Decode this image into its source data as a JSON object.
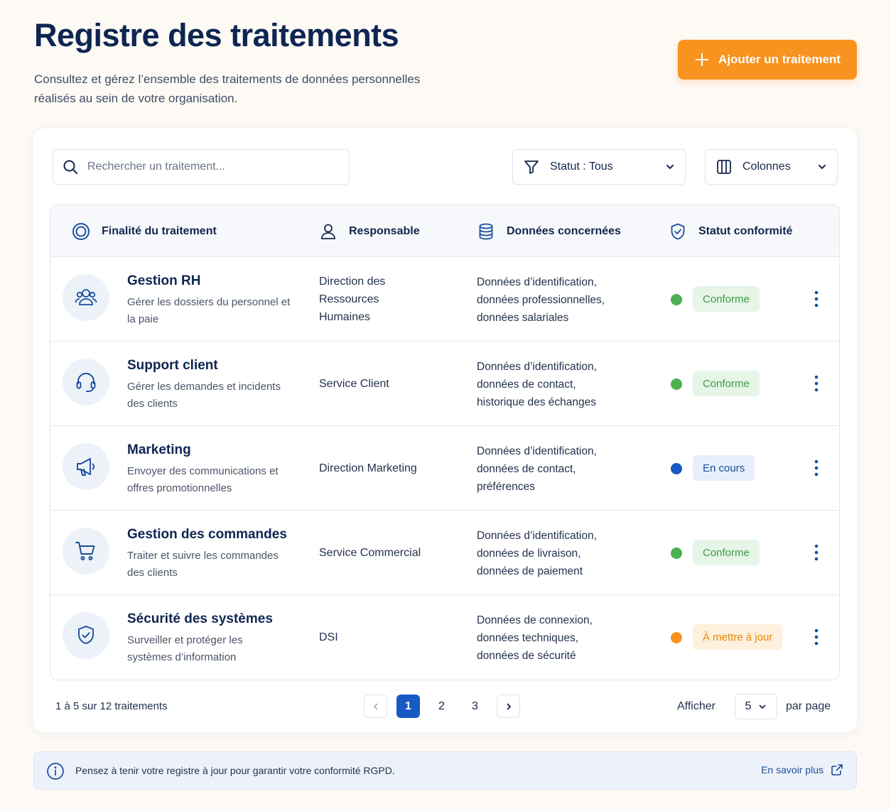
{
  "header": {
    "title": "Registre des traitements",
    "subtitle_line1": "Consultez et gérez l’ensemble des traitements de données personnelles",
    "subtitle_line2": "réalisés au sein de votre organisation.",
    "add_button_label": "Ajouter un traitement"
  },
  "toolbar": {
    "search_placeholder": "Rechercher un traitement...",
    "status_filter_label": "Statut : Tous",
    "columns_label": "Colonnes"
  },
  "table": {
    "columns": [
      "Finalité du traitement",
      "Responsable",
      "Données concernées",
      "Statut conformité"
    ],
    "rows": [
      {
        "icon": "users-icon",
        "title": "Gestion RH",
        "description": "Gérer les dossiers du personnel et la paie",
        "responsible": "Direction des Ressources Humaines",
        "data": [
          "Données d’identification,",
          "données professionnelles,",
          "données salariales"
        ],
        "status": "Conforme",
        "status_color": "#4caf50"
      },
      {
        "icon": "headset-icon",
        "title": "Support client",
        "description": "Gérer les demandes et incidents des clients",
        "responsible": "Service Client",
        "data": [
          "Données d’identification,",
          "données de contact,",
          "historique des échanges"
        ],
        "status": "Conforme",
        "status_color": "#4caf50"
      },
      {
        "icon": "megaphone-icon",
        "title": "Marketing",
        "description": "Envoyer des communications et offres promotionnelles",
        "responsible": "Direction Marketing",
        "data": [
          "Données d’identification,",
          "données de contact,",
          "préférences"
        ],
        "status": "En cours",
        "status_color": "#1859c5"
      },
      {
        "icon": "cart-icon",
        "title": "Gestion des commandes",
        "description": "Traiter et suivre les commandes des clients",
        "responsible": "Service Commercial",
        "data": [
          "Données d’identification,",
          "données de livraison,",
          "données de paiement"
        ],
        "status": "Conforme",
        "status_color": "#4caf50"
      },
      {
        "icon": "shield-check-icon",
        "title": "Sécurité des systèmes",
        "description": "Surveiller et protéger les systèmes d’information",
        "responsible": "DSI",
        "data": [
          "Données de connexion,",
          "données techniques,",
          "données de sécurité"
        ],
        "status": "À mettre à jour",
        "status_color": "#f7931e"
      }
    ]
  },
  "pagination": {
    "info": "1 à 5 sur 12 traitements",
    "pages": [
      "1",
      "2",
      "3"
    ],
    "current_page": "1",
    "show_label": "Afficher",
    "per_page_value": "5",
    "per_page_label": "par page"
  },
  "banner": {
    "text": "Pensez à tenir votre registre à jour pour garantir votre conformité RGPD.",
    "link_label": "En savoir plus"
  },
  "colors": {
    "accent": "#f7931e",
    "primary": "#1859c5",
    "title": "#0f2552",
    "success": "#4caf50",
    "warning": "#f7931e"
  }
}
